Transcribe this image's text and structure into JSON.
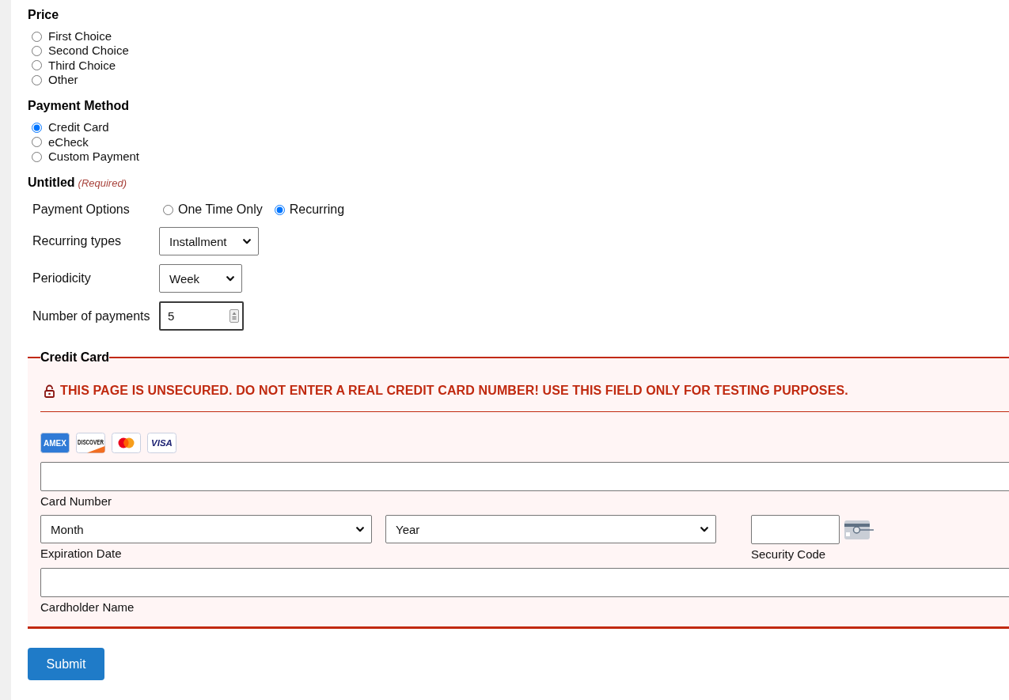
{
  "groups": [
    {
      "title": "Price",
      "options": [
        {
          "label": "First Choice",
          "selected": false
        },
        {
          "label": "Second Choice",
          "selected": false
        },
        {
          "label": "Third Choice",
          "selected": false
        },
        {
          "label": "Other",
          "selected": false
        }
      ]
    },
    {
      "title": "Payment Method",
      "options": [
        {
          "label": "Credit Card",
          "selected": true
        },
        {
          "label": "eCheck",
          "selected": false
        },
        {
          "label": "Custom Payment",
          "selected": false
        }
      ]
    }
  ],
  "untitled": {
    "title": "Untitled",
    "required_note": "(Required)",
    "rows": [
      {
        "kind": "radios",
        "label": "Payment Options",
        "options": [
          {
            "label": "One Time Only",
            "selected": false
          },
          {
            "label": "Recurring",
            "selected": true
          }
        ]
      },
      {
        "kind": "select",
        "label": "Recurring types",
        "value": "Installment"
      },
      {
        "kind": "select",
        "label": "Periodicity",
        "value": "Week"
      },
      {
        "kind": "number",
        "label": "Number of payments",
        "value": "5",
        "focused": true
      }
    ]
  },
  "credit_card": {
    "legend": "Credit Card",
    "warning": "THIS PAGE IS UNSECURED. DO NOT ENTER A REAL CREDIT CARD NUMBER! USE THIS FIELD ONLY FOR TESTING PURPOSES.",
    "brands": [
      {
        "kind": "amex",
        "label": "AMEX"
      },
      {
        "kind": "discover",
        "label": "DISCOVER"
      },
      {
        "kind": "mastercard"
      },
      {
        "kind": "visa",
        "label": "VISA"
      }
    ],
    "card_number": {
      "label": "Card Number"
    },
    "expiration": {
      "month": "Month",
      "year": "Year",
      "label": "Expiration Date"
    },
    "security_code": {
      "label": "Security Code"
    },
    "cardholder_name": {
      "label": "Cardholder Name"
    }
  },
  "submit": {
    "label": "Submit"
  }
}
